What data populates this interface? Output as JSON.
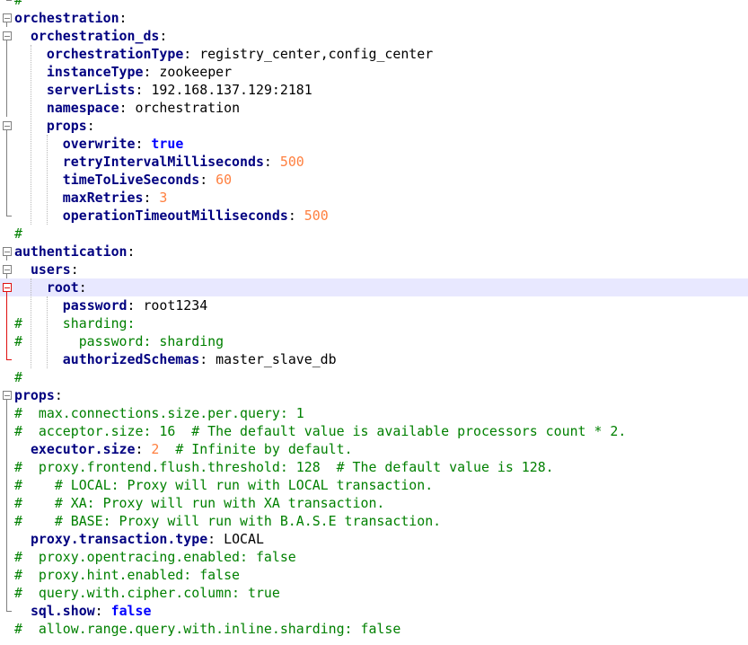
{
  "lines": [
    {
      "ind": "",
      "k": "",
      "v": "",
      "c": "#",
      "fold": "end"
    },
    {
      "ind": "",
      "k": "orchestration",
      "v": "",
      "c": "",
      "fold": "box"
    },
    {
      "ind": "  ",
      "k": "orchestration_ds",
      "v": "",
      "c": "",
      "fold": "box"
    },
    {
      "ind": "    ",
      "k": "orchestrationType",
      "v": "registry_center,config_center",
      "vt": "val",
      "c": "",
      "fold": "line"
    },
    {
      "ind": "    ",
      "k": "instanceType",
      "v": "zookeeper",
      "vt": "val",
      "c": "",
      "fold": "line"
    },
    {
      "ind": "    ",
      "k": "serverLists",
      "v": "192.168.137.129:2181",
      "vt": "val",
      "c": "",
      "fold": "line"
    },
    {
      "ind": "    ",
      "k": "namespace",
      "v": "orchestration",
      "vt": "val",
      "c": "",
      "fold": "line"
    },
    {
      "ind": "    ",
      "k": "props",
      "v": "",
      "c": "",
      "fold": "box"
    },
    {
      "ind": "      ",
      "k": "overwrite",
      "v": "true",
      "vt": "kw",
      "c": "",
      "fold": "line"
    },
    {
      "ind": "      ",
      "k": "retryIntervalMilliseconds",
      "v": "500",
      "vt": "num",
      "c": "",
      "fold": "line"
    },
    {
      "ind": "      ",
      "k": "timeToLiveSeconds",
      "v": "60",
      "vt": "num",
      "c": "",
      "fold": "line"
    },
    {
      "ind": "      ",
      "k": "maxRetries",
      "v": "3",
      "vt": "num",
      "c": "",
      "fold": "line"
    },
    {
      "ind": "      ",
      "k": "operationTimeoutMilliseconds",
      "v": "500",
      "vt": "num",
      "c": "",
      "fold": "end"
    },
    {
      "ind": "",
      "k": "",
      "v": "",
      "c": "#",
      "fold": ""
    },
    {
      "ind": "",
      "k": "authentication",
      "v": "",
      "c": "",
      "fold": "box"
    },
    {
      "ind": "  ",
      "k": "users",
      "v": "",
      "c": "",
      "fold": "box"
    },
    {
      "ind": "    ",
      "k": "root",
      "v": "",
      "c": "",
      "fold": "boxred",
      "hl": true
    },
    {
      "ind": "      ",
      "k": "password",
      "v": "root1234",
      "vt": "val",
      "c": "",
      "fold": "linered"
    },
    {
      "ind": "",
      "k": "",
      "v": "",
      "c": "#     sharding:",
      "fold": "linered"
    },
    {
      "ind": "",
      "k": "",
      "v": "",
      "c": "#       password: sharding",
      "fold": "linered"
    },
    {
      "ind": "      ",
      "k": "authorizedSchemas",
      "v": "master_slave_db",
      "vt": "val",
      "c": "",
      "fold": "endred"
    },
    {
      "ind": "",
      "k": "",
      "v": "",
      "c": "#",
      "fold": ""
    },
    {
      "ind": "",
      "k": "props",
      "v": "",
      "c": "",
      "fold": "box"
    },
    {
      "ind": "",
      "k": "",
      "v": "",
      "c": "#  max.connections.size.per.query: 1",
      "fold": "line"
    },
    {
      "ind": "",
      "k": "",
      "v": "",
      "c": "#  acceptor.size: 16  # The default value is available processors count * 2.",
      "fold": "line"
    },
    {
      "ind": "  ",
      "k": "executor.size",
      "v": "2",
      "vt": "num",
      "c": "  # Infinite by default.",
      "fold": "line"
    },
    {
      "ind": "",
      "k": "",
      "v": "",
      "c": "#  proxy.frontend.flush.threshold: 128  # The default value is 128.",
      "fold": "line"
    },
    {
      "ind": "",
      "k": "",
      "v": "",
      "c": "#    # LOCAL: Proxy will run with LOCAL transaction.",
      "fold": "line"
    },
    {
      "ind": "",
      "k": "",
      "v": "",
      "c": "#    # XA: Proxy will run with XA transaction.",
      "fold": "line"
    },
    {
      "ind": "",
      "k": "",
      "v": "",
      "c": "#    # BASE: Proxy will run with B.A.S.E transaction.",
      "fold": "line"
    },
    {
      "ind": "  ",
      "k": "proxy.transaction.type",
      "v": "LOCAL",
      "vt": "val",
      "c": "",
      "fold": "line"
    },
    {
      "ind": "",
      "k": "",
      "v": "",
      "c": "#  proxy.opentracing.enabled: false",
      "fold": "line"
    },
    {
      "ind": "",
      "k": "",
      "v": "",
      "c": "#  proxy.hint.enabled: false",
      "fold": "line"
    },
    {
      "ind": "",
      "k": "",
      "v": "",
      "c": "#  query.with.cipher.column: true",
      "fold": "line"
    },
    {
      "ind": "  ",
      "k": "sql.show",
      "v": "false",
      "vt": "kw",
      "c": "",
      "fold": "end"
    },
    {
      "ind": "",
      "k": "",
      "v": "",
      "c": "#  allow.range.query.with.inline.sharding: false",
      "fold": ""
    }
  ]
}
